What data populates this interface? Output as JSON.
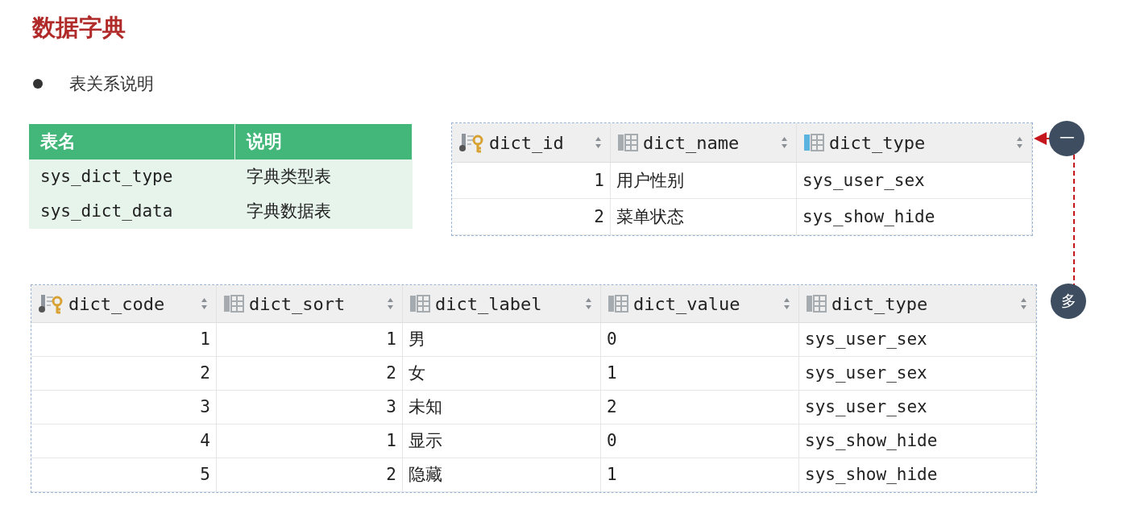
{
  "title": "数据字典",
  "bullet": "表关系说明",
  "summary_table": {
    "columns": [
      "表名",
      "说明"
    ],
    "rows": [
      [
        "sys_dict_type",
        "字典类型表"
      ],
      [
        "sys_dict_data",
        "字典数据表"
      ]
    ]
  },
  "type_table": {
    "columns": [
      {
        "name": "dict_id",
        "kind": "key"
      },
      {
        "name": "dict_name",
        "kind": "text"
      },
      {
        "name": "dict_type",
        "kind": "indexed"
      }
    ],
    "rows": [
      [
        "1",
        "用户性别",
        "sys_user_sex"
      ],
      [
        "2",
        "菜单状态",
        "sys_show_hide"
      ]
    ]
  },
  "data_table": {
    "columns": [
      {
        "name": "dict_code",
        "kind": "key"
      },
      {
        "name": "dict_sort",
        "kind": "number"
      },
      {
        "name": "dict_label",
        "kind": "text"
      },
      {
        "name": "dict_value",
        "kind": "text"
      },
      {
        "name": "dict_type",
        "kind": "text"
      }
    ],
    "rows": [
      [
        "1",
        "1",
        "男",
        "0",
        "sys_user_sex"
      ],
      [
        "2",
        "2",
        "女",
        "1",
        "sys_user_sex"
      ],
      [
        "3",
        "3",
        "未知",
        "2",
        "sys_user_sex"
      ],
      [
        "4",
        "1",
        "显示",
        "0",
        "sys_show_hide"
      ],
      [
        "5",
        "2",
        "隐藏",
        "1",
        "sys_show_hide"
      ]
    ]
  },
  "relation": {
    "one_label": "一",
    "many_label": "多"
  }
}
